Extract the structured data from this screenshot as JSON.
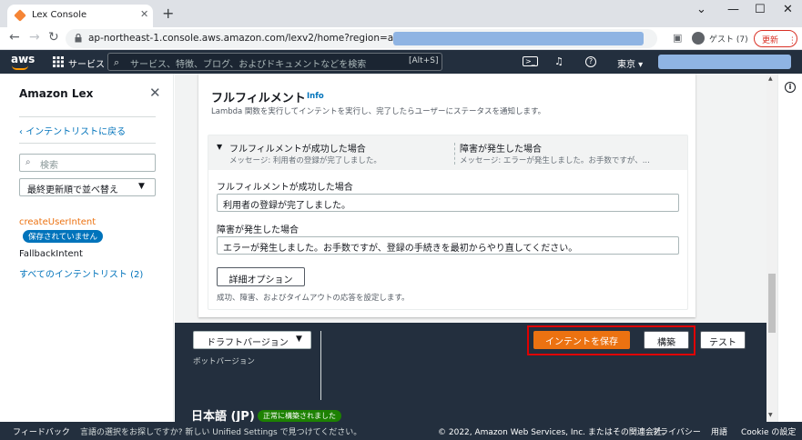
{
  "browser": {
    "tab_title": "Lex Console",
    "url": "ap-northeast-1.console.aws.amazon.com/lexv2/home?region=ap-northeast-1#",
    "profile_label": "ゲスト (7)",
    "update_label": "更新"
  },
  "aws_nav": {
    "logo": "aws",
    "services_label": "サービス",
    "search_placeholder": "サービス、特徴、ブログ、およびドキュメントなどを検索",
    "search_shortcut": "[Alt+S]",
    "region_label": "東京 ▾"
  },
  "sidebar": {
    "title": "Amazon Lex",
    "back_link": "インテントリストに戻る",
    "search_placeholder": "検索",
    "sort_label": "最終更新順で並べ替え",
    "intents": [
      {
        "name": "createUserIntent",
        "badge": "保存されていません"
      },
      {
        "name": "FallbackIntent"
      }
    ],
    "all_intents_link": "すべてのインテントリスト (2)"
  },
  "fulfillment": {
    "title": "フルフィルメント",
    "info_link": "Info",
    "description": "Lambda 関数を実行してインテントを実行し、完了したらユーザーにステータスを通知します。",
    "success_header": "フルフィルメントが成功した場合",
    "success_message_summary": "メッセージ: 利用者の登録が完了しました。",
    "failure_header": "障害が発生した場合",
    "failure_message_summary": "メッセージ: エラーが発生しました。お手数ですが、...",
    "success_field_label": "フルフィルメントが成功した場合",
    "success_field_value": "利用者の登録が完了しました。",
    "failure_field_label": "障害が発生した場合",
    "failure_field_value": "エラーが発生しました。お手数ですが、登録の手続きを最初からやり直してください。",
    "advanced_button": "詳細オプション",
    "advanced_description": "成功、障害、およびタイムアウトの応答を設定します。"
  },
  "bottom_bar": {
    "draft_select": "ドラフトバージョン",
    "bot_version_label": "ボットバージョン",
    "save_button": "インテントを保存",
    "build_button": "構築",
    "test_button": "テスト",
    "language_label": "日本語 (JP)",
    "built_badge": "正常に構築されました"
  },
  "footer": {
    "feedback": "フィードバック",
    "language_prompt": "言語の選択をお探しですか? 新しい Unified Settings で見つけてください。",
    "copyright": "© 2022, Amazon Web Services, Inc. またはその関連会社。",
    "privacy": "プライバシー",
    "terms": "用語",
    "cookie": "Cookie の設定"
  },
  "colors": {
    "aws_dark": "#232f3e",
    "primary_orange": "#ec7211",
    "link_blue": "#0073bb",
    "success_green": "#1d8102",
    "highlight_red": "#e00000"
  }
}
